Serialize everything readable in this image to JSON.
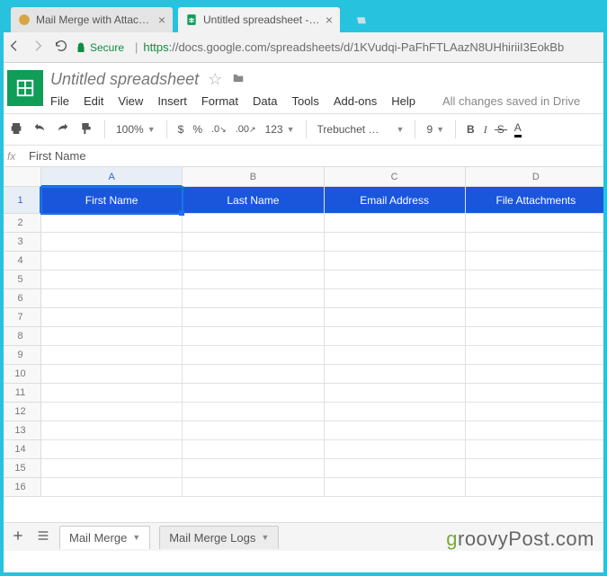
{
  "browser": {
    "tabs": [
      {
        "label": "Mail Merge with Attachm",
        "active": false
      },
      {
        "label": "Untitled spreadsheet - G",
        "active": true
      }
    ],
    "secure_label": "Secure",
    "url_prefix": "https",
    "url_host": "://docs.google.com",
    "url_path": "/spreadsheets/d/1KVudqi-PaFhFTLAazN8UHhiriiI3EokBb"
  },
  "doc": {
    "title": "Untitled spreadsheet"
  },
  "menubar": [
    "File",
    "Edit",
    "View",
    "Insert",
    "Format",
    "Data",
    "Tools",
    "Add-ons",
    "Help"
  ],
  "saved_label": "All changes saved in Drive",
  "toolbar": {
    "zoom": "100%",
    "currency": "$",
    "percent": "%",
    "dec_dec": ".0",
    "dec_inc": ".00",
    "more_formats": "123",
    "font": "Trebuchet …",
    "font_size": "9",
    "bold": "B",
    "italic": "I",
    "strike": "S",
    "text_color": "A"
  },
  "formula_bar": {
    "fx": "fx",
    "value": "First Name"
  },
  "grid": {
    "columns": [
      "A",
      "B",
      "C",
      "D"
    ],
    "header_cells": [
      "First Name",
      "Last Name",
      "Email Address",
      "File Attachments"
    ],
    "row_count": 16,
    "active": {
      "row": 1,
      "col": 0
    }
  },
  "sheet_tabs": [
    {
      "label": "Mail Merge",
      "active": true
    },
    {
      "label": "Mail Merge Logs",
      "active": false
    }
  ],
  "watermark": {
    "g": "g",
    "rest": "roovyPost.com"
  }
}
